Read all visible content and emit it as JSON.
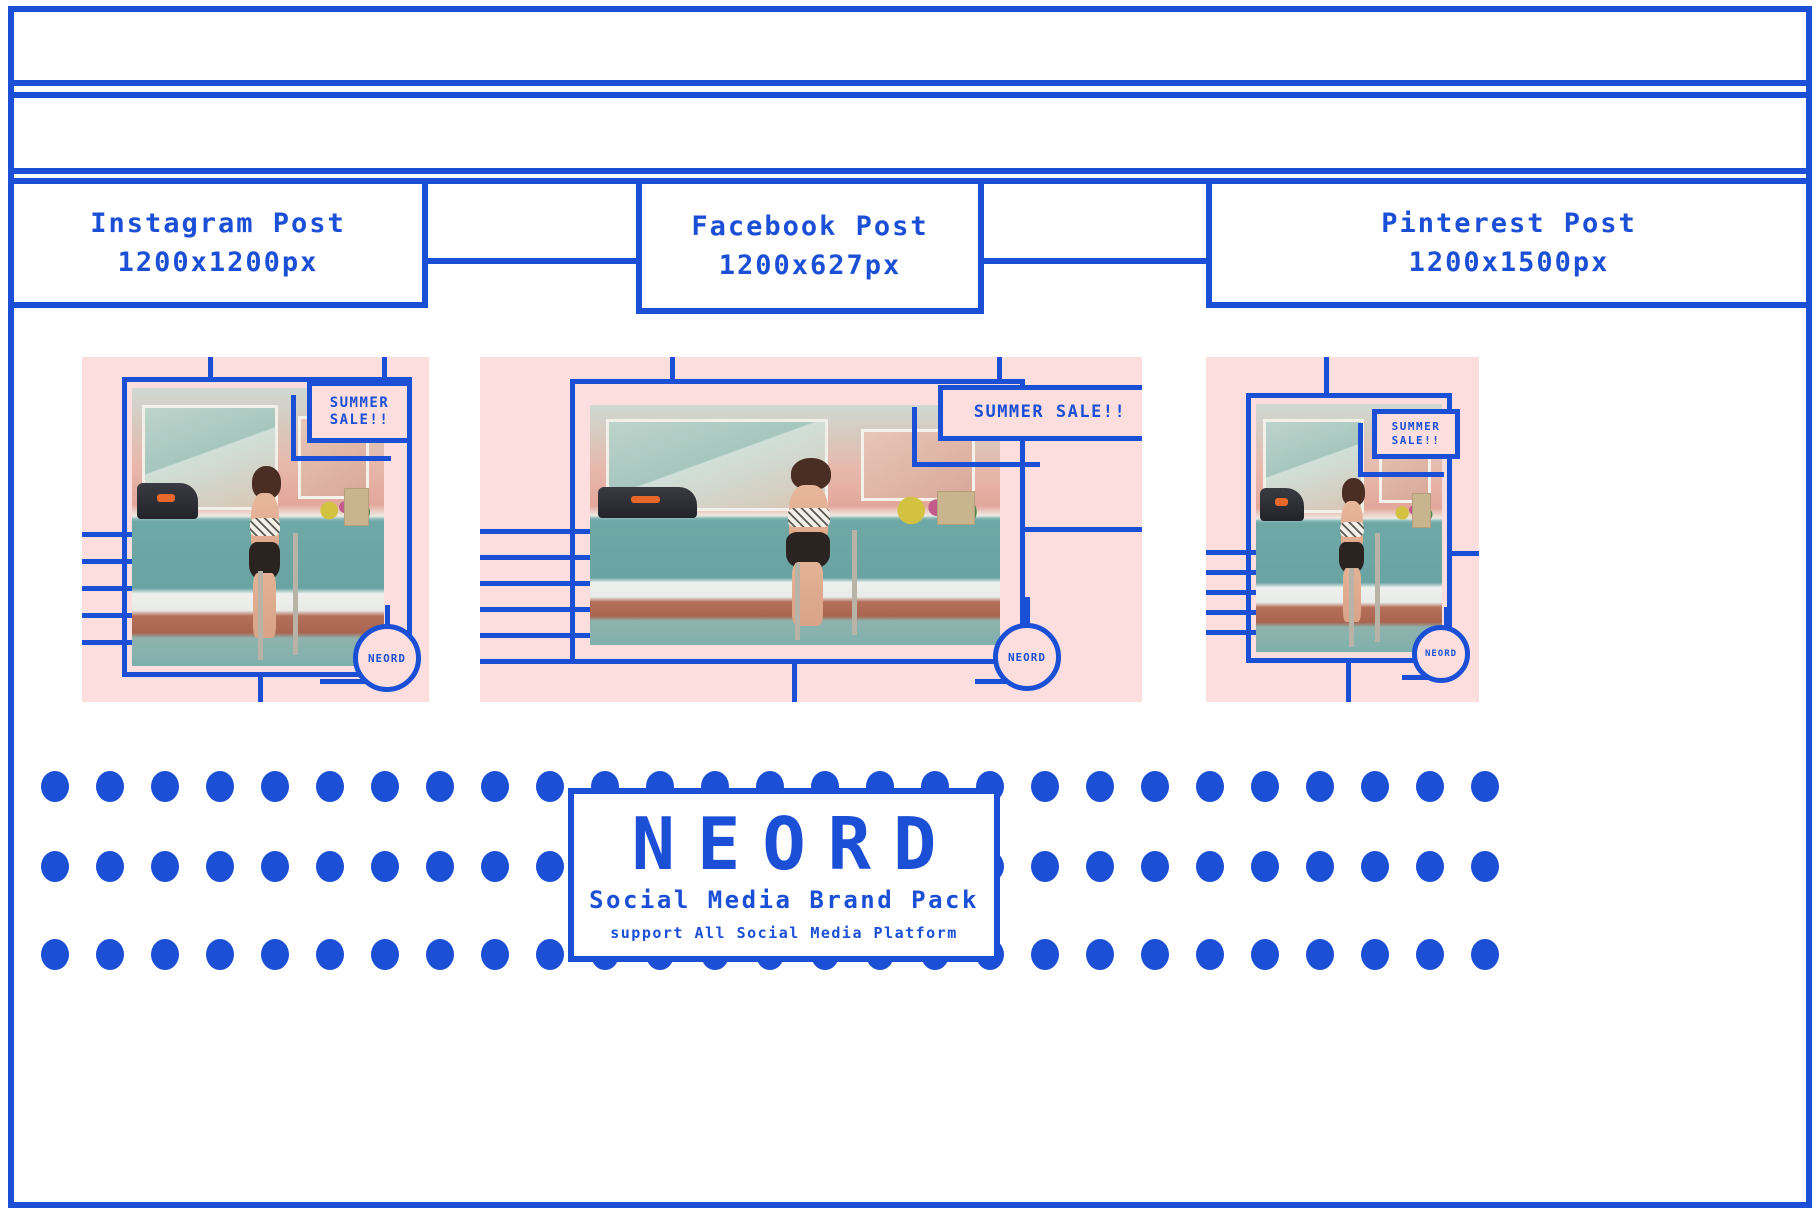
{
  "theme": {
    "brand_blue": "#1a4fd6",
    "card_pink": "#fbdedd",
    "page_bg": "#ffffff"
  },
  "header": {
    "top_bars": [
      "",
      ""
    ],
    "labels": [
      {
        "name": "Instagram Post",
        "size": "1200x1200px"
      },
      {
        "name": "Facebook Post",
        "size": "1200x627px"
      },
      {
        "name": "Pinterest Post",
        "size": "1200x1500px"
      }
    ]
  },
  "mockups": [
    {
      "id": "instagram",
      "platform": "Instagram Post",
      "dimensions": "1200x1200px",
      "sale_text": "SUMMER\nSALE!!",
      "sale_line1": "SUMMER",
      "sale_line2": "SALE!!",
      "badge_text": "NEORD",
      "stripe_count": 5
    },
    {
      "id": "facebook",
      "platform": "Facebook Post",
      "dimensions": "1200x627px",
      "sale_text": "SUMMER SALE!!",
      "sale_line1": "SUMMER SALE!!",
      "sale_line2": "",
      "badge_text": "NEORD",
      "stripe_count": 6
    },
    {
      "id": "pinterest",
      "platform": "Pinterest Post",
      "dimensions": "1200x1500px",
      "sale_text": "SUMMER\nSALE!!",
      "sale_line1": "SUMMER",
      "sale_line2": "SALE!!",
      "badge_text": "NEORD",
      "stripe_count": 5
    }
  ],
  "dots": {
    "rows": 3,
    "per_row": 27
  },
  "logo": {
    "word": "NEORD",
    "subtitle": "Social Media Brand Pack",
    "support": "support All Social Media Platform"
  }
}
